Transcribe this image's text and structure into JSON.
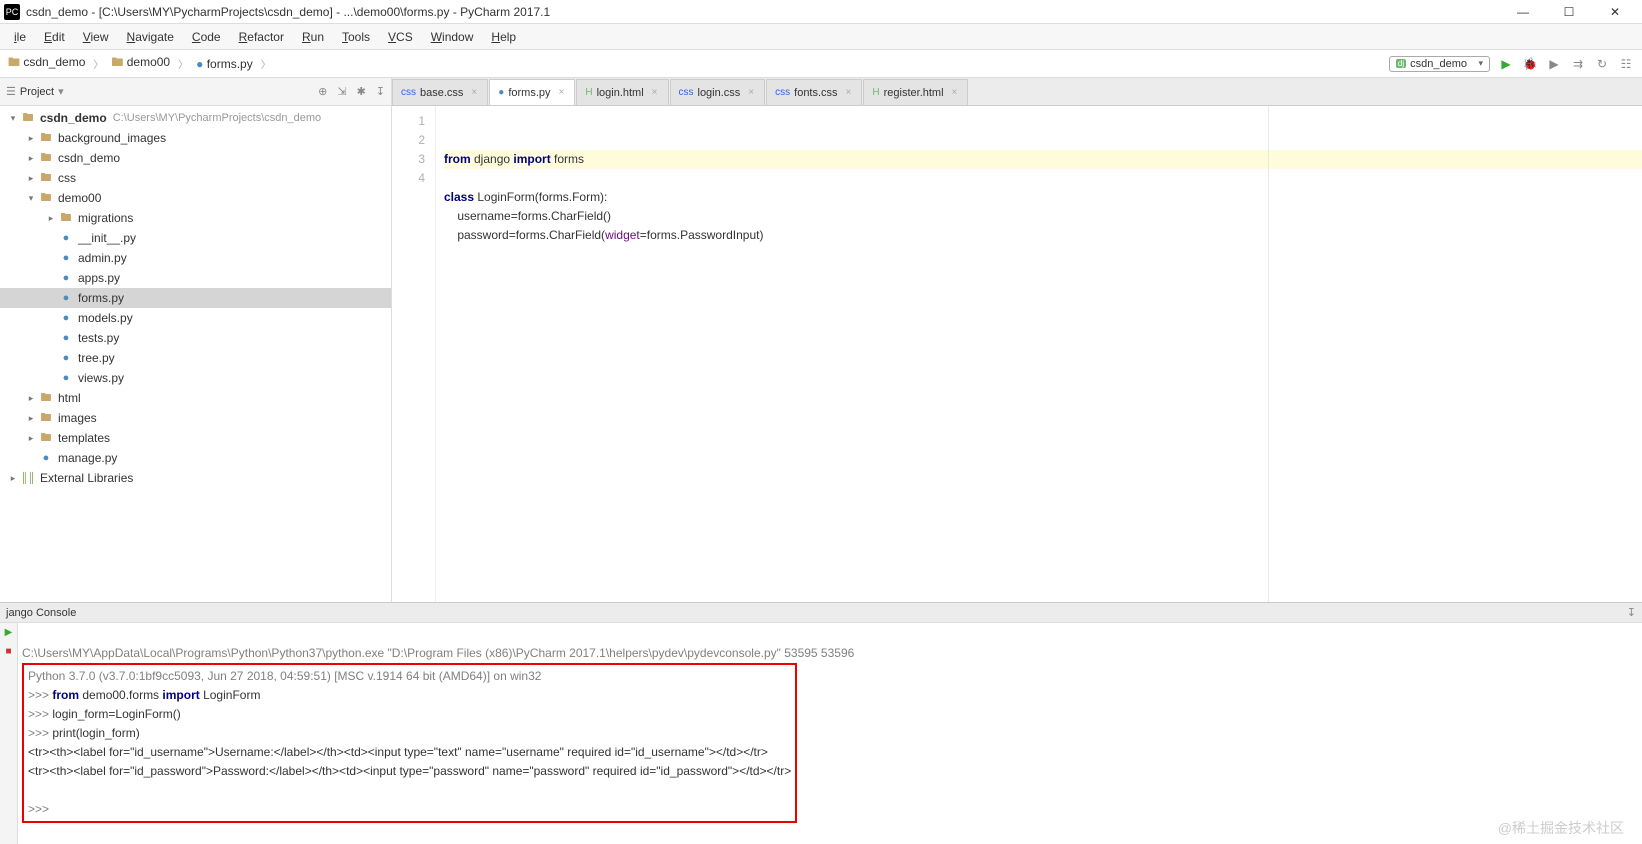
{
  "title": "csdn_demo - [C:\\Users\\MY\\PycharmProjects\\csdn_demo] - ...\\demo00\\forms.py - PyCharm 2017.1",
  "menus": [
    "ile",
    "Edit",
    "View",
    "Navigate",
    "Code",
    "Refactor",
    "Run",
    "Tools",
    "VCS",
    "Window",
    "Help"
  ],
  "breadcrumbs": [
    {
      "icon": "folder",
      "text": "csdn_demo"
    },
    {
      "icon": "folder",
      "text": "demo00"
    },
    {
      "icon": "py",
      "text": "forms.py"
    }
  ],
  "run_config": {
    "icon": "dj",
    "label": "csdn_demo"
  },
  "sidebar": {
    "title": "Project",
    "tree": [
      {
        "lvl": 0,
        "arrow": "down",
        "icon": "dir",
        "bold": "csdn_demo",
        "sub": "C:\\Users\\MY\\PycharmProjects\\csdn_demo"
      },
      {
        "lvl": 1,
        "arrow": "right",
        "icon": "dir",
        "text": "background_images"
      },
      {
        "lvl": 1,
        "arrow": "right",
        "icon": "dir",
        "text": "csdn_demo"
      },
      {
        "lvl": 1,
        "arrow": "right",
        "icon": "dir",
        "text": "css"
      },
      {
        "lvl": 1,
        "arrow": "down",
        "icon": "dir",
        "text": "demo00"
      },
      {
        "lvl": 2,
        "arrow": "right",
        "icon": "dir",
        "text": "migrations"
      },
      {
        "lvl": 2,
        "arrow": "",
        "icon": "py",
        "text": "__init__.py"
      },
      {
        "lvl": 2,
        "arrow": "",
        "icon": "py",
        "text": "admin.py"
      },
      {
        "lvl": 2,
        "arrow": "",
        "icon": "py",
        "text": "apps.py"
      },
      {
        "lvl": 2,
        "arrow": "",
        "icon": "py",
        "text": "forms.py",
        "selected": true
      },
      {
        "lvl": 2,
        "arrow": "",
        "icon": "py",
        "text": "models.py"
      },
      {
        "lvl": 2,
        "arrow": "",
        "icon": "py",
        "text": "tests.py"
      },
      {
        "lvl": 2,
        "arrow": "",
        "icon": "py",
        "text": "tree.py"
      },
      {
        "lvl": 2,
        "arrow": "",
        "icon": "py",
        "text": "views.py"
      },
      {
        "lvl": 1,
        "arrow": "right",
        "icon": "dir",
        "text": "html"
      },
      {
        "lvl": 1,
        "arrow": "right",
        "icon": "dir",
        "text": "images"
      },
      {
        "lvl": 1,
        "arrow": "right",
        "icon": "dir",
        "text": "templates"
      },
      {
        "lvl": 1,
        "arrow": "",
        "icon": "py",
        "text": "manage.py"
      },
      {
        "lvl": 0,
        "arrow": "right",
        "icon": "lib",
        "text": "External Libraries"
      }
    ]
  },
  "tabs": [
    {
      "kind": "css",
      "label": "base.css"
    },
    {
      "kind": "py",
      "label": "forms.py",
      "active": true
    },
    {
      "kind": "html",
      "label": "login.html"
    },
    {
      "kind": "css",
      "label": "login.css"
    },
    {
      "kind": "css",
      "label": "fonts.css"
    },
    {
      "kind": "html",
      "label": "register.html"
    }
  ],
  "code": {
    "line1_from": "from ",
    "line1_pkg": "django ",
    "line1_import": "import ",
    "line1_mod": "forms",
    "line2_class": "class ",
    "line2_name": "LoginForm(forms.Form):",
    "line3": "    username=forms.CharField()",
    "line4_a": "    password=forms.CharField(",
    "line4_widget": "widget",
    "line4_b": "=forms.PasswordInput)"
  },
  "console": {
    "title": "jango Console",
    "cmd": "C:\\Users\\MY\\AppData\\Local\\Programs\\Python\\Python37\\python.exe \"D:\\Program Files (x86)\\PyCharm 2017.1\\helpers\\pydev\\pydevconsole.py\" 53595 53596",
    "banner": "Python 3.7.0 (v3.7.0:1bf9cc5093, Jun 27 2018, 04:59:51) [MSC v.1914 64 bit (AMD64)] on win32",
    "l1_a": ">>> ",
    "l1_from": "from ",
    "l1_mid": "demo00.forms ",
    "l1_import": "import ",
    "l1_end": "LoginForm",
    "l2": ">>> login_form=LoginForm()",
    "l3": ">>> print(login_form)",
    "out1": "<tr><th><label for=\"id_username\">Username:</label></th><td><input type=\"text\" name=\"username\" required id=\"id_username\"></td></tr>",
    "out2": "<tr><th><label for=\"id_password\">Password:</label></th><td><input type=\"password\" name=\"password\" required id=\"id_password\"></td></tr>",
    "prompt": ">>> "
  },
  "watermark": "@稀土掘金技术社区"
}
